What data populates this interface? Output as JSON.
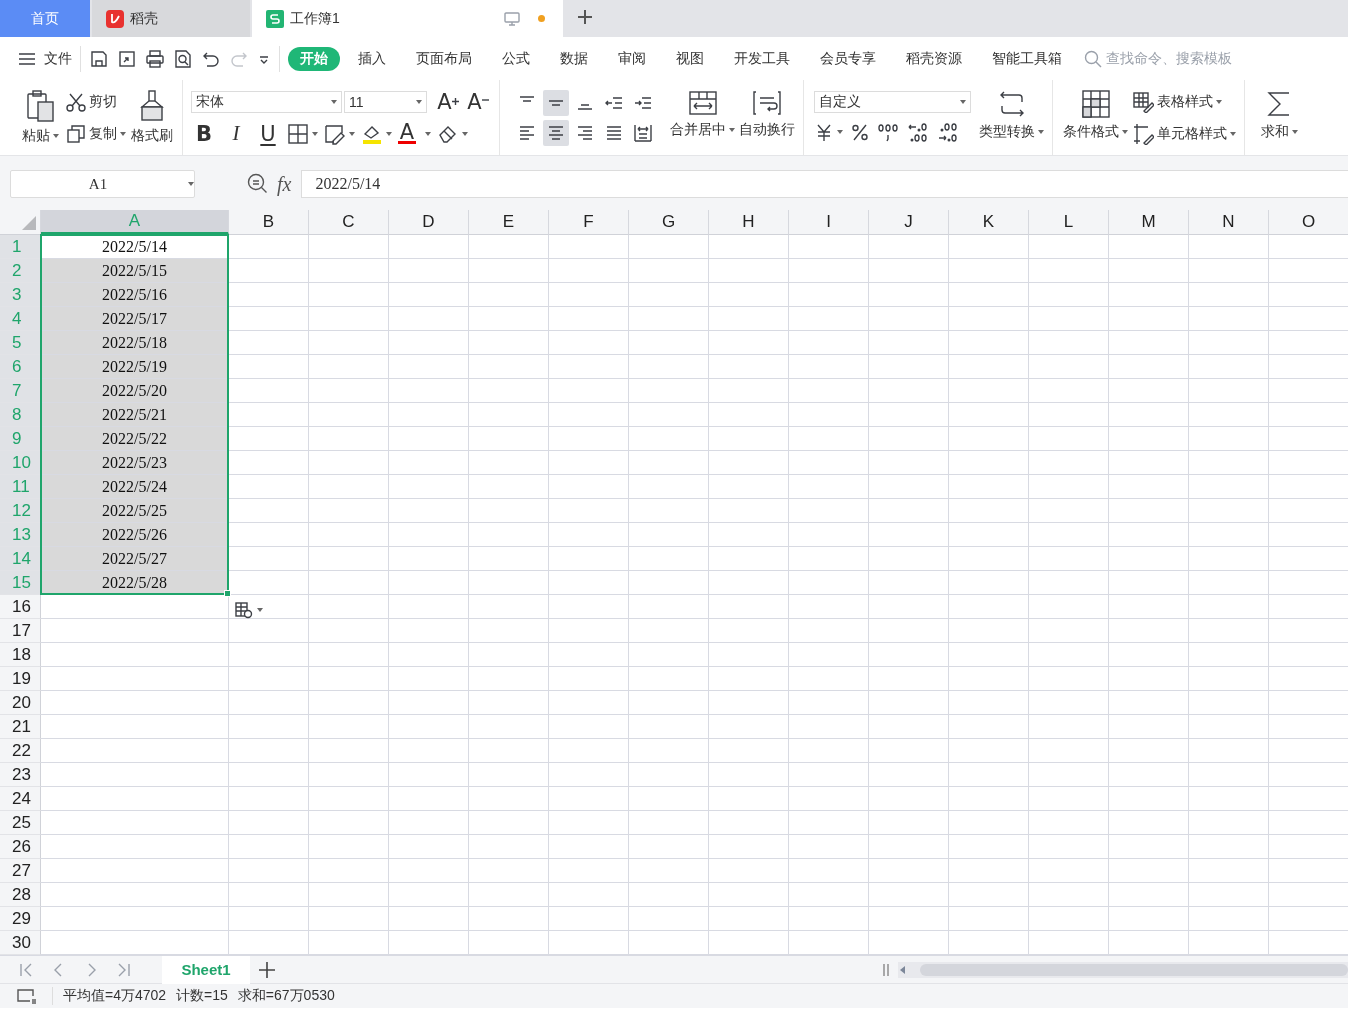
{
  "doc_tabs": [
    {
      "label": "首页",
      "kind": "home",
      "selected": false
    },
    {
      "label": "稻壳",
      "kind": "docer",
      "selected": false
    },
    {
      "label": "工作簿1",
      "kind": "sheet",
      "selected": true,
      "unsaved": true
    }
  ],
  "file_menu": "文件",
  "menu_tabs": [
    {
      "label": "开始",
      "selected": true
    },
    {
      "label": "插入",
      "selected": false
    },
    {
      "label": "页面布局",
      "selected": false
    },
    {
      "label": "公式",
      "selected": false
    },
    {
      "label": "数据",
      "selected": false
    },
    {
      "label": "审阅",
      "selected": false
    },
    {
      "label": "视图",
      "selected": false
    },
    {
      "label": "开发工具",
      "selected": false
    },
    {
      "label": "会员专享",
      "selected": false
    },
    {
      "label": "稻壳资源",
      "selected": false
    },
    {
      "label": "智能工具箱",
      "selected": false
    }
  ],
  "search": {
    "placeholder": "查找命令、搜索模板"
  },
  "ribbon": {
    "paste": "粘贴",
    "cut": "剪切",
    "copy": "复制",
    "format_painter": "格式刷",
    "font": "宋体",
    "font_size": "11",
    "font_buttons": [
      {
        "kind": "bold",
        "glyph": "B"
      },
      {
        "kind": "italic",
        "glyph": "I"
      },
      {
        "kind": "underline",
        "glyph": "U"
      }
    ],
    "grow_glyph": "A",
    "shrink_glyph": "A",
    "color_glyph": "A",
    "align_buttons": [
      {
        "kind": "top",
        "selected": false
      },
      {
        "kind": "middle",
        "selected": true
      },
      {
        "kind": "bottom",
        "selected": false
      },
      {
        "kind": "outdent",
        "selected": false
      },
      {
        "kind": "indent",
        "selected": false
      },
      {
        "kind": "left",
        "selected": false
      },
      {
        "kind": "center",
        "selected": true
      },
      {
        "kind": "right",
        "selected": false
      },
      {
        "kind": "justify",
        "selected": false
      },
      {
        "kind": "distributed",
        "selected": false
      }
    ],
    "merge": "合并居中",
    "wrap": "自动换行",
    "number_format": "自定义",
    "convert": "类型转换",
    "conditional": "条件格式",
    "table_style": "表格样式",
    "cell_style": "单元格样式",
    "sum": "求和"
  },
  "name_box": "A1",
  "fx_label": "fx",
  "formula": "2022/5/14",
  "columns": [
    {
      "label": "A",
      "selected": true
    },
    {
      "label": "B",
      "selected": false
    },
    {
      "label": "C",
      "selected": false
    },
    {
      "label": "D",
      "selected": false
    },
    {
      "label": "E",
      "selected": false
    },
    {
      "label": "F",
      "selected": false
    },
    {
      "label": "G",
      "selected": false
    },
    {
      "label": "H",
      "selected": false
    },
    {
      "label": "I",
      "selected": false
    },
    {
      "label": "J",
      "selected": false
    },
    {
      "label": "K",
      "selected": false
    },
    {
      "label": "L",
      "selected": false
    },
    {
      "label": "M",
      "selected": false
    },
    {
      "label": "N",
      "selected": false
    },
    {
      "label": "O",
      "selected": false
    }
  ],
  "rows": [
    {
      "number": "1",
      "cells": [
        "2022/5/14"
      ],
      "selected": true,
      "active": true
    },
    {
      "number": "2",
      "cells": [
        "2022/5/15"
      ],
      "selected": true,
      "active": false
    },
    {
      "number": "3",
      "cells": [
        "2022/5/16"
      ],
      "selected": true,
      "active": false
    },
    {
      "number": "4",
      "cells": [
        "2022/5/17"
      ],
      "selected": true,
      "active": false
    },
    {
      "number": "5",
      "cells": [
        "2022/5/18"
      ],
      "selected": true,
      "active": false
    },
    {
      "number": "6",
      "cells": [
        "2022/5/19"
      ],
      "selected": true,
      "active": false
    },
    {
      "number": "7",
      "cells": [
        "2022/5/20"
      ],
      "selected": true,
      "active": false
    },
    {
      "number": "8",
      "cells": [
        "2022/5/21"
      ],
      "selected": true,
      "active": false
    },
    {
      "number": "9",
      "cells": [
        "2022/5/22"
      ],
      "selected": true,
      "active": false
    },
    {
      "number": "10",
      "cells": [
        "2022/5/23"
      ],
      "selected": true,
      "active": false
    },
    {
      "number": "11",
      "cells": [
        "2022/5/24"
      ],
      "selected": true,
      "active": false
    },
    {
      "number": "12",
      "cells": [
        "2022/5/25"
      ],
      "selected": true,
      "active": false
    },
    {
      "number": "13",
      "cells": [
        "2022/5/26"
      ],
      "selected": true,
      "active": false
    },
    {
      "number": "14",
      "cells": [
        "2022/5/27"
      ],
      "selected": true,
      "active": false
    },
    {
      "number": "15",
      "cells": [
        "2022/5/28"
      ],
      "selected": true,
      "active": false
    },
    {
      "number": "16",
      "selected": false
    },
    {
      "number": "17",
      "selected": false
    },
    {
      "number": "18",
      "selected": false
    },
    {
      "number": "19",
      "selected": false
    },
    {
      "number": "20",
      "selected": false
    },
    {
      "number": "21",
      "selected": false
    },
    {
      "number": "22",
      "selected": false
    },
    {
      "number": "23",
      "selected": false
    },
    {
      "number": "24",
      "selected": false
    },
    {
      "number": "25",
      "selected": false
    },
    {
      "number": "26",
      "selected": false
    },
    {
      "number": "27",
      "selected": false
    },
    {
      "number": "28",
      "selected": false
    },
    {
      "number": "29",
      "selected": false
    },
    {
      "number": "30",
      "selected": false
    }
  ],
  "sheets": [
    {
      "label": "Sheet1",
      "selected": true
    }
  ],
  "status_items": [
    "平均值=4万4702",
    "计数=15",
    "求和=67万0530"
  ]
}
